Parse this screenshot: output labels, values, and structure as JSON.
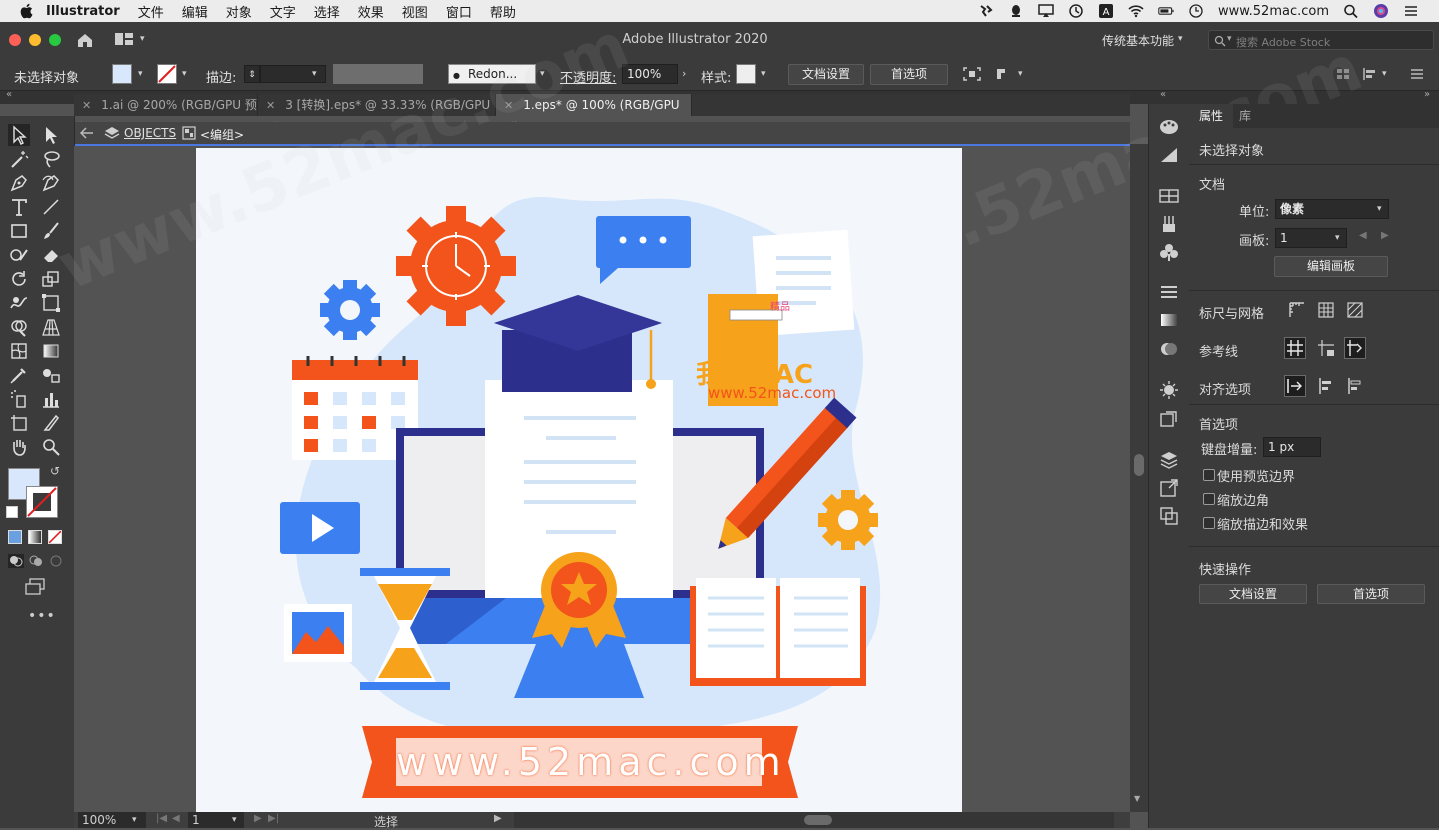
{
  "menubar": {
    "app": "Illustrator",
    "items": [
      "文件",
      "编辑",
      "对象",
      "文字",
      "选择",
      "效果",
      "视图",
      "窗口",
      "帮助"
    ],
    "site": "www.52mac.com"
  },
  "titlebar": {
    "title": "Adobe Illustrator 2020",
    "workspace": "传统基本功能",
    "stock_placeholder": "搜索 Adobe Stock"
  },
  "controlbar": {
    "selection": "未选择对象",
    "stroke_label": "描边:",
    "brush_value": "Redon...",
    "opacity_label": "不透明度:",
    "opacity_value": "100%",
    "style_label": "样式:",
    "doc_settings": "文档设置",
    "preferences": "首选项"
  },
  "tabs": [
    {
      "label": "1.ai @ 200% (RGB/GPU 预览)"
    },
    {
      "label": "3 [转换].eps* @ 33.33% (RGB/GPU 预览)"
    },
    {
      "label": "1.eps* @ 100% (RGB/GPU 预览)"
    }
  ],
  "breadcrumb": {
    "layer": "OBJECTS",
    "group": "<编组>"
  },
  "artwork": {
    "logo_cn": "我爱MAC",
    "logo_url": "www.52mac.com",
    "banner_text": "www.52mac.com",
    "badge_text": "精品"
  },
  "statusbar": {
    "zoom": "100%",
    "artboard": "1",
    "tool": "选择"
  },
  "panel": {
    "tab_properties": "属性",
    "tab_library": "库",
    "no_selection": "未选择对象",
    "document_heading": "文档",
    "unit_label": "单位:",
    "unit_value": "像素",
    "artboard_label": "画板:",
    "artboard_value": "1",
    "edit_artboard": "编辑画板",
    "rulers_grid": "标尺与网格",
    "guides": "参考线",
    "align_options": "对齐选项",
    "preferences_heading": "首选项",
    "keyboard_increment_label": "键盘增量:",
    "keyboard_increment_value": "1 px",
    "use_preview_bounds": "使用预览边界",
    "scale_corners": "缩放边角",
    "scale_strokes": "缩放描边和效果",
    "quick_actions": "快速操作",
    "doc_settings_btn": "文档设置",
    "prefs_btn": "首选项"
  },
  "watermarks": [
    "www.52mac.com",
    ".52mac.com",
    "52mac.com"
  ],
  "colors": {
    "accent_orange": "#f2541b",
    "artwork_blue": "#3b7ff0",
    "navy": "#2c2f8c",
    "amber": "#f7a21b"
  }
}
